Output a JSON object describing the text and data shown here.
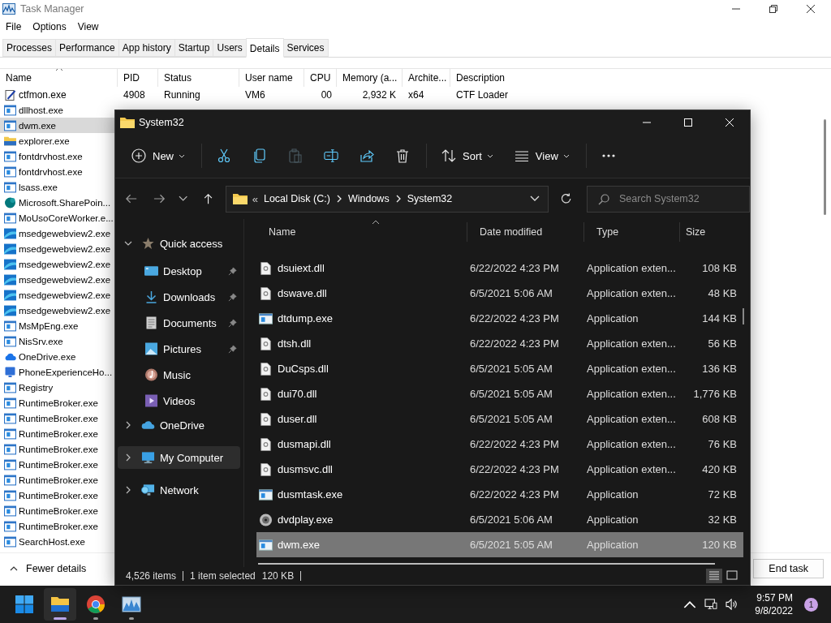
{
  "task_manager": {
    "title": "Task Manager",
    "menu": [
      "File",
      "Options",
      "View"
    ],
    "tabs": [
      {
        "label": "Processes",
        "selected": false
      },
      {
        "label": "Performance",
        "selected": false
      },
      {
        "label": "App history",
        "selected": false
      },
      {
        "label": "Startup",
        "selected": false
      },
      {
        "label": "Users",
        "selected": false
      },
      {
        "label": "Details",
        "selected": true
      },
      {
        "label": "Services",
        "selected": false
      }
    ],
    "columns": [
      "Name",
      "PID",
      "Status",
      "User name",
      "CPU",
      "Memory (a...",
      "Archite...",
      "Description"
    ],
    "rows": [
      {
        "kind": "pen",
        "name": "ctfmon.exe",
        "pid": "4908",
        "status": "Running",
        "user": "VM6",
        "cpu": "00",
        "memory": "2,932 K",
        "arch": "x64",
        "description": "CTF Loader",
        "selected": false
      },
      {
        "kind": "exe",
        "name": "dllhost.exe",
        "selected": false
      },
      {
        "kind": "exe",
        "name": "dwm.exe",
        "selected": true
      },
      {
        "kind": "folder",
        "name": "explorer.exe",
        "selected": false
      },
      {
        "kind": "exe",
        "name": "fontdrvhost.exe",
        "selected": false
      },
      {
        "kind": "exe",
        "name": "fontdrvhost.exe",
        "selected": false
      },
      {
        "kind": "exe",
        "name": "lsass.exe",
        "selected": false
      },
      {
        "kind": "sharepoint",
        "name": "Microsoft.SharePoin...",
        "selected": false
      },
      {
        "kind": "exe",
        "name": "MoUsoCoreWorker.e...",
        "selected": false
      },
      {
        "kind": "edge",
        "name": "msedgewebview2.exe",
        "selected": false
      },
      {
        "kind": "edge",
        "name": "msedgewebview2.exe",
        "selected": false
      },
      {
        "kind": "edge",
        "name": "msedgewebview2.exe",
        "selected": false
      },
      {
        "kind": "edge",
        "name": "msedgewebview2.exe",
        "selected": false
      },
      {
        "kind": "edge",
        "name": "msedgewebview2.exe",
        "selected": false
      },
      {
        "kind": "edge",
        "name": "msedgewebview2.exe",
        "selected": false
      },
      {
        "kind": "exe",
        "name": "MsMpEng.exe",
        "selected": false
      },
      {
        "kind": "exe",
        "name": "NisSrv.exe",
        "selected": false
      },
      {
        "kind": "onedrive",
        "name": "OneDrive.exe",
        "selected": false
      },
      {
        "kind": "phone",
        "name": "PhoneExperienceHo...",
        "selected": false
      },
      {
        "kind": "exe",
        "name": "Registry",
        "selected": false
      },
      {
        "kind": "exe",
        "name": "RuntimeBroker.exe",
        "selected": false
      },
      {
        "kind": "exe",
        "name": "RuntimeBroker.exe",
        "selected": false
      },
      {
        "kind": "exe",
        "name": "RuntimeBroker.exe",
        "selected": false
      },
      {
        "kind": "exe",
        "name": "RuntimeBroker.exe",
        "selected": false
      },
      {
        "kind": "exe",
        "name": "RuntimeBroker.exe",
        "selected": false
      },
      {
        "kind": "exe",
        "name": "RuntimeBroker.exe",
        "selected": false
      },
      {
        "kind": "exe",
        "name": "RuntimeBroker.exe",
        "selected": false
      },
      {
        "kind": "exe",
        "name": "RuntimeBroker.exe",
        "selected": false
      },
      {
        "kind": "exe",
        "name": "RuntimeBroker.exe",
        "selected": false
      },
      {
        "kind": "exe",
        "name": "SearchHost.exe",
        "selected": false
      }
    ],
    "fewer_details": "Fewer details",
    "end_task": "End task"
  },
  "explorer": {
    "title": "System32",
    "toolbar": [
      {
        "kind": "new",
        "label": "New",
        "disabled": false
      },
      {
        "kind": "cut",
        "disabled": false
      },
      {
        "kind": "copy",
        "disabled": false
      },
      {
        "kind": "paste",
        "disabled": true
      },
      {
        "kind": "rename",
        "disabled": false
      },
      {
        "kind": "share",
        "disabled": false
      },
      {
        "kind": "delete",
        "disabled": false
      },
      {
        "kind": "sort",
        "label": "Sort",
        "disabled": false
      },
      {
        "kind": "view",
        "label": "View",
        "disabled": false
      },
      {
        "kind": "more",
        "disabled": false
      }
    ],
    "breadcrumb_overflow": "«",
    "breadcrumb": [
      "Local Disk (C:)",
      "Windows",
      "System32"
    ],
    "search_placeholder": "Search System32",
    "nav": [
      {
        "kind": "star",
        "label": "Quick access",
        "expanded": true,
        "selected": false,
        "children": [
          {
            "kind": "desktop",
            "label": "Desktop",
            "pinned": true
          },
          {
            "kind": "downloads",
            "label": "Downloads",
            "pinned": true
          },
          {
            "kind": "documents",
            "label": "Documents",
            "pinned": true
          },
          {
            "kind": "pictures",
            "label": "Pictures",
            "pinned": true
          },
          {
            "kind": "music",
            "label": "Music",
            "pinned": false
          },
          {
            "kind": "videos",
            "label": "Videos",
            "pinned": false
          }
        ]
      },
      {
        "kind": "onedrive",
        "label": "OneDrive",
        "expanded": false,
        "selected": false
      },
      {
        "kind": "computer",
        "label": "My Computer",
        "expanded": false,
        "selected": true
      },
      {
        "kind": "network",
        "label": "Network",
        "expanded": false,
        "selected": false
      }
    ],
    "columns": [
      "Name",
      "Date modified",
      "Type",
      "Size"
    ],
    "files": [
      {
        "kind": "dll",
        "name": "dsuiext.dll",
        "date": "6/22/2022 4:23 PM",
        "type": "Application exten...",
        "size": "108 KB",
        "selected": false
      },
      {
        "kind": "dll",
        "name": "dswave.dll",
        "date": "6/5/2021 5:06 AM",
        "type": "Application exten...",
        "size": "48 KB",
        "selected": false
      },
      {
        "kind": "exe",
        "name": "dtdump.exe",
        "date": "6/22/2022 4:23 PM",
        "type": "Application",
        "size": "144 KB",
        "selected": false
      },
      {
        "kind": "dll",
        "name": "dtsh.dll",
        "date": "6/22/2022 4:23 PM",
        "type": "Application exten...",
        "size": "56 KB",
        "selected": false
      },
      {
        "kind": "dll",
        "name": "DuCsps.dll",
        "date": "6/5/2021 5:05 AM",
        "type": "Application exten...",
        "size": "136 KB",
        "selected": false
      },
      {
        "kind": "dll",
        "name": "dui70.dll",
        "date": "6/5/2021 5:05 AM",
        "type": "Application exten...",
        "size": "1,776 KB",
        "selected": false
      },
      {
        "kind": "dll",
        "name": "duser.dll",
        "date": "6/5/2021 5:05 AM",
        "type": "Application exten...",
        "size": "608 KB",
        "selected": false
      },
      {
        "kind": "dll",
        "name": "dusmapi.dll",
        "date": "6/22/2022 4:23 PM",
        "type": "Application exten...",
        "size": "76 KB",
        "selected": false
      },
      {
        "kind": "dll",
        "name": "dusmsvc.dll",
        "date": "6/22/2022 4:23 PM",
        "type": "Application exten...",
        "size": "420 KB",
        "selected": false
      },
      {
        "kind": "exe",
        "name": "dusmtask.exe",
        "date": "6/22/2022 4:23 PM",
        "type": "Application",
        "size": "72 KB",
        "selected": false
      },
      {
        "kind": "dvd",
        "name": "dvdplay.exe",
        "date": "6/5/2021 5:06 AM",
        "type": "Application",
        "size": "32 KB",
        "selected": false
      },
      {
        "kind": "exe",
        "name": "dwm.exe",
        "date": "6/5/2021 5:05 AM",
        "type": "Application",
        "size": "120 KB",
        "selected": true
      }
    ],
    "status": {
      "count": "4,526 items",
      "selection": "1 item selected",
      "size": "120 KB"
    },
    "views": [
      {
        "kind": "details",
        "selected": true
      },
      {
        "kind": "tiles",
        "selected": false
      }
    ]
  },
  "taskbar": {
    "apps": [
      {
        "kind": "start",
        "open": false,
        "active": false
      },
      {
        "kind": "explorer",
        "open": true,
        "active": true
      },
      {
        "kind": "chrome",
        "open": true,
        "active": false
      },
      {
        "kind": "taskmgr",
        "open": true,
        "active": false
      }
    ],
    "time": "9:57 PM",
    "date": "9/8/2022",
    "notifications": "1"
  }
}
